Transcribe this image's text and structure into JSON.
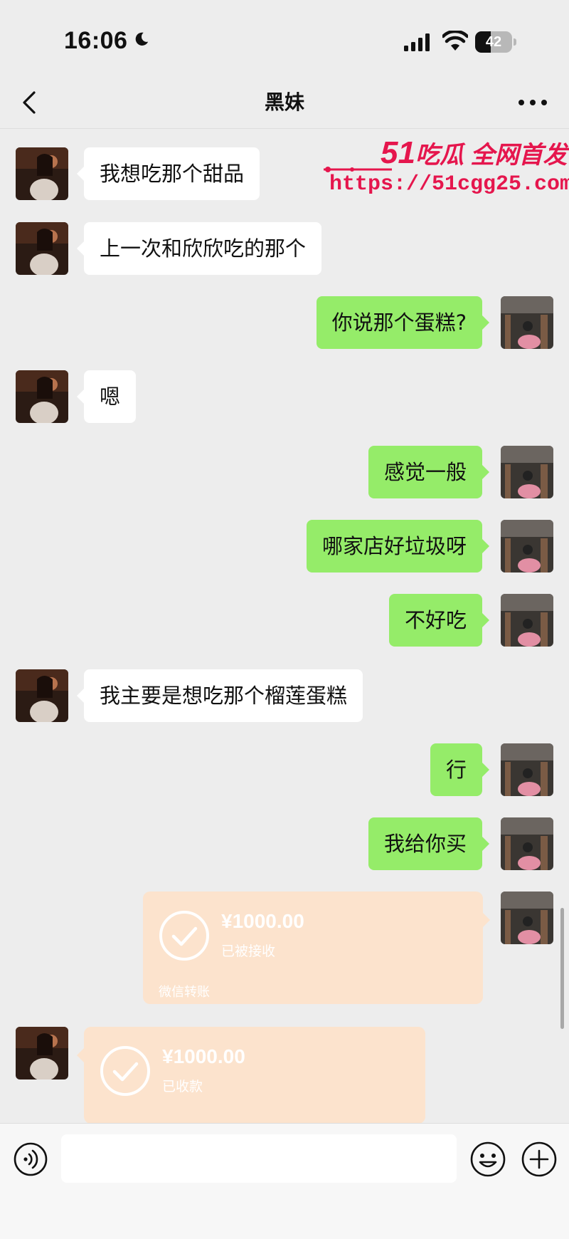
{
  "status_bar": {
    "time": "16:06",
    "battery_level": "42",
    "battery_fraction": 0.42
  },
  "header": {
    "back_icon": "chevron-left-icon",
    "title": "黑妹",
    "more_icon": "more-dots-icon"
  },
  "watermark": {
    "brand_num": "51",
    "brand_text": "吃瓜 全网首发",
    "url": "https://51cgg25.com"
  },
  "messages": [
    {
      "side": "left",
      "text": "我想吃那个甜品"
    },
    {
      "side": "left",
      "text": "上一次和欣欣吃的那个"
    },
    {
      "side": "right",
      "text": "你说那个蛋糕?"
    },
    {
      "side": "left",
      "text": "嗯"
    },
    {
      "side": "right",
      "text": "感觉一般"
    },
    {
      "side": "right",
      "text": "哪家店好垃圾呀"
    },
    {
      "side": "right",
      "text": "不好吃"
    },
    {
      "side": "left",
      "text": "我主要是想吃那个榴莲蛋糕"
    },
    {
      "side": "right",
      "text": "行"
    },
    {
      "side": "right",
      "text": "我给你买"
    },
    {
      "side": "right",
      "type": "transfer",
      "amount": "¥1000.00",
      "status": "已被接收",
      "footer": "微信转账"
    },
    {
      "side": "left",
      "type": "transfer",
      "amount": "¥1000.00",
      "status": "已收款"
    }
  ],
  "input_bar": {
    "voice_icon": "voice-icon",
    "input_value": "",
    "emoji_icon": "emoji-icon",
    "plus_icon": "plus-icon"
  },
  "colors": {
    "background": "#ededed",
    "self_bubble": "#95ec69",
    "other_bubble": "#ffffff",
    "transfer_bubble": "#fce3cd",
    "watermark": "#e5164d"
  }
}
